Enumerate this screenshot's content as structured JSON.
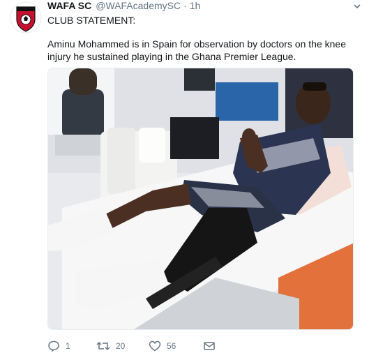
{
  "tweet": {
    "name": "WAFA SC",
    "handle": "@WAFAcademySC",
    "separator": "·",
    "time": "1h",
    "line1": "CLUB STATEMENT:",
    "line2": "Aminu Mohammed is in Spain for observation by doctors on the knee injury he sustained playing in the Ghana Premier League."
  },
  "actions": {
    "reply_count": "1",
    "retweet_count": "20",
    "like_count": "56"
  },
  "icons": {
    "avatar": "wafa-crest",
    "menu": "chevron-down-icon",
    "reply": "reply-icon",
    "retweet": "retweet-icon",
    "like": "heart-icon",
    "message": "envelope-icon"
  },
  "colors": {
    "text": "#14171a",
    "muted": "#657786",
    "crest_red": "#c8102e"
  }
}
